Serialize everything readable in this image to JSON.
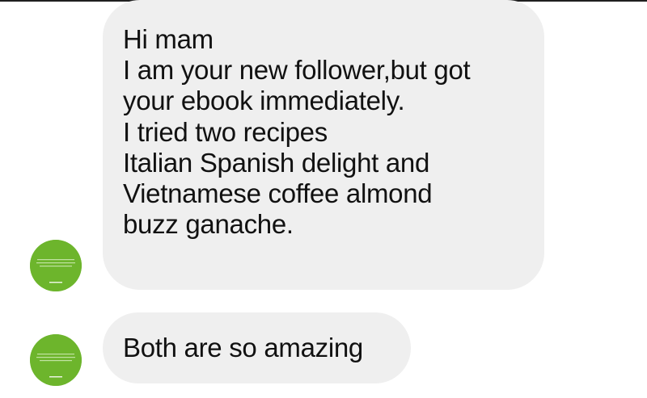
{
  "conversation": {
    "messages": [
      {
        "lines": [
          "Hi mam",
          "I am your new follower,but got",
          "your ebook immediately.",
          "I tried two recipes",
          "Italian Spanish delight and",
          "Vietnamese coffee almond",
          "buzz ganache."
        ]
      },
      {
        "lines": [
          "Both are so amazing"
        ]
      }
    ],
    "avatar_color": "#6db52c",
    "bubble_color": "#efefef",
    "text_color": "#111111"
  }
}
